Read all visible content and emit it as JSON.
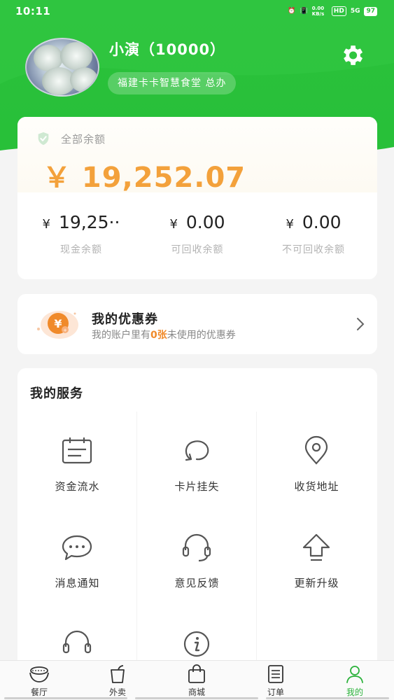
{
  "status_bar": {
    "time": "10:11",
    "net_speed": "0.00 KB/s",
    "hd": "HD",
    "signal": "5G",
    "battery": "97"
  },
  "profile": {
    "name": "小演（10000）",
    "org": "福建卡卡智慧食堂  总办",
    "settings_icon": "gear-icon"
  },
  "balance": {
    "total_label": "全部余额",
    "total_amount": "￥ 19,252.07",
    "columns": [
      {
        "currency": "¥",
        "amount": "19,25··",
        "label": "现金余额"
      },
      {
        "currency": "¥",
        "amount": "0.00",
        "label": "可回收余额"
      },
      {
        "currency": "¥",
        "amount": "0.00",
        "label": "不可回收余额"
      }
    ]
  },
  "coupon": {
    "title": "我的优惠券",
    "desc_prefix": "我的账户里有",
    "count": "0张",
    "desc_suffix": "未使用的优惠券"
  },
  "services": {
    "title": "我的服务",
    "items": [
      {
        "label": "资金流水",
        "icon": "calendar-icon"
      },
      {
        "label": "卡片挂失",
        "icon": "loop-icon"
      },
      {
        "label": "收货地址",
        "icon": "location-pin-icon"
      },
      {
        "label": "消息通知",
        "icon": "chat-bubble-icon"
      },
      {
        "label": "意见反馈",
        "icon": "headset-icon"
      },
      {
        "label": "更新升级",
        "icon": "upgrade-arrow-icon"
      },
      {
        "label": "",
        "icon": "headset-icon"
      },
      {
        "label": "",
        "icon": "info-icon"
      }
    ]
  },
  "nav": {
    "items": [
      {
        "label": "餐厅",
        "icon": "bowl-icon"
      },
      {
        "label": "外卖",
        "icon": "takeout-icon"
      },
      {
        "label": "商城",
        "icon": "shopping-bag-icon"
      },
      {
        "label": "订单",
        "icon": "order-list-icon"
      },
      {
        "label": "我的",
        "icon": "user-icon"
      }
    ],
    "active_index": 4
  },
  "colors": {
    "brand_green": "#2bc23c",
    "amount_orange": "#f3a13b",
    "highlight_orange": "#f08a2a"
  }
}
